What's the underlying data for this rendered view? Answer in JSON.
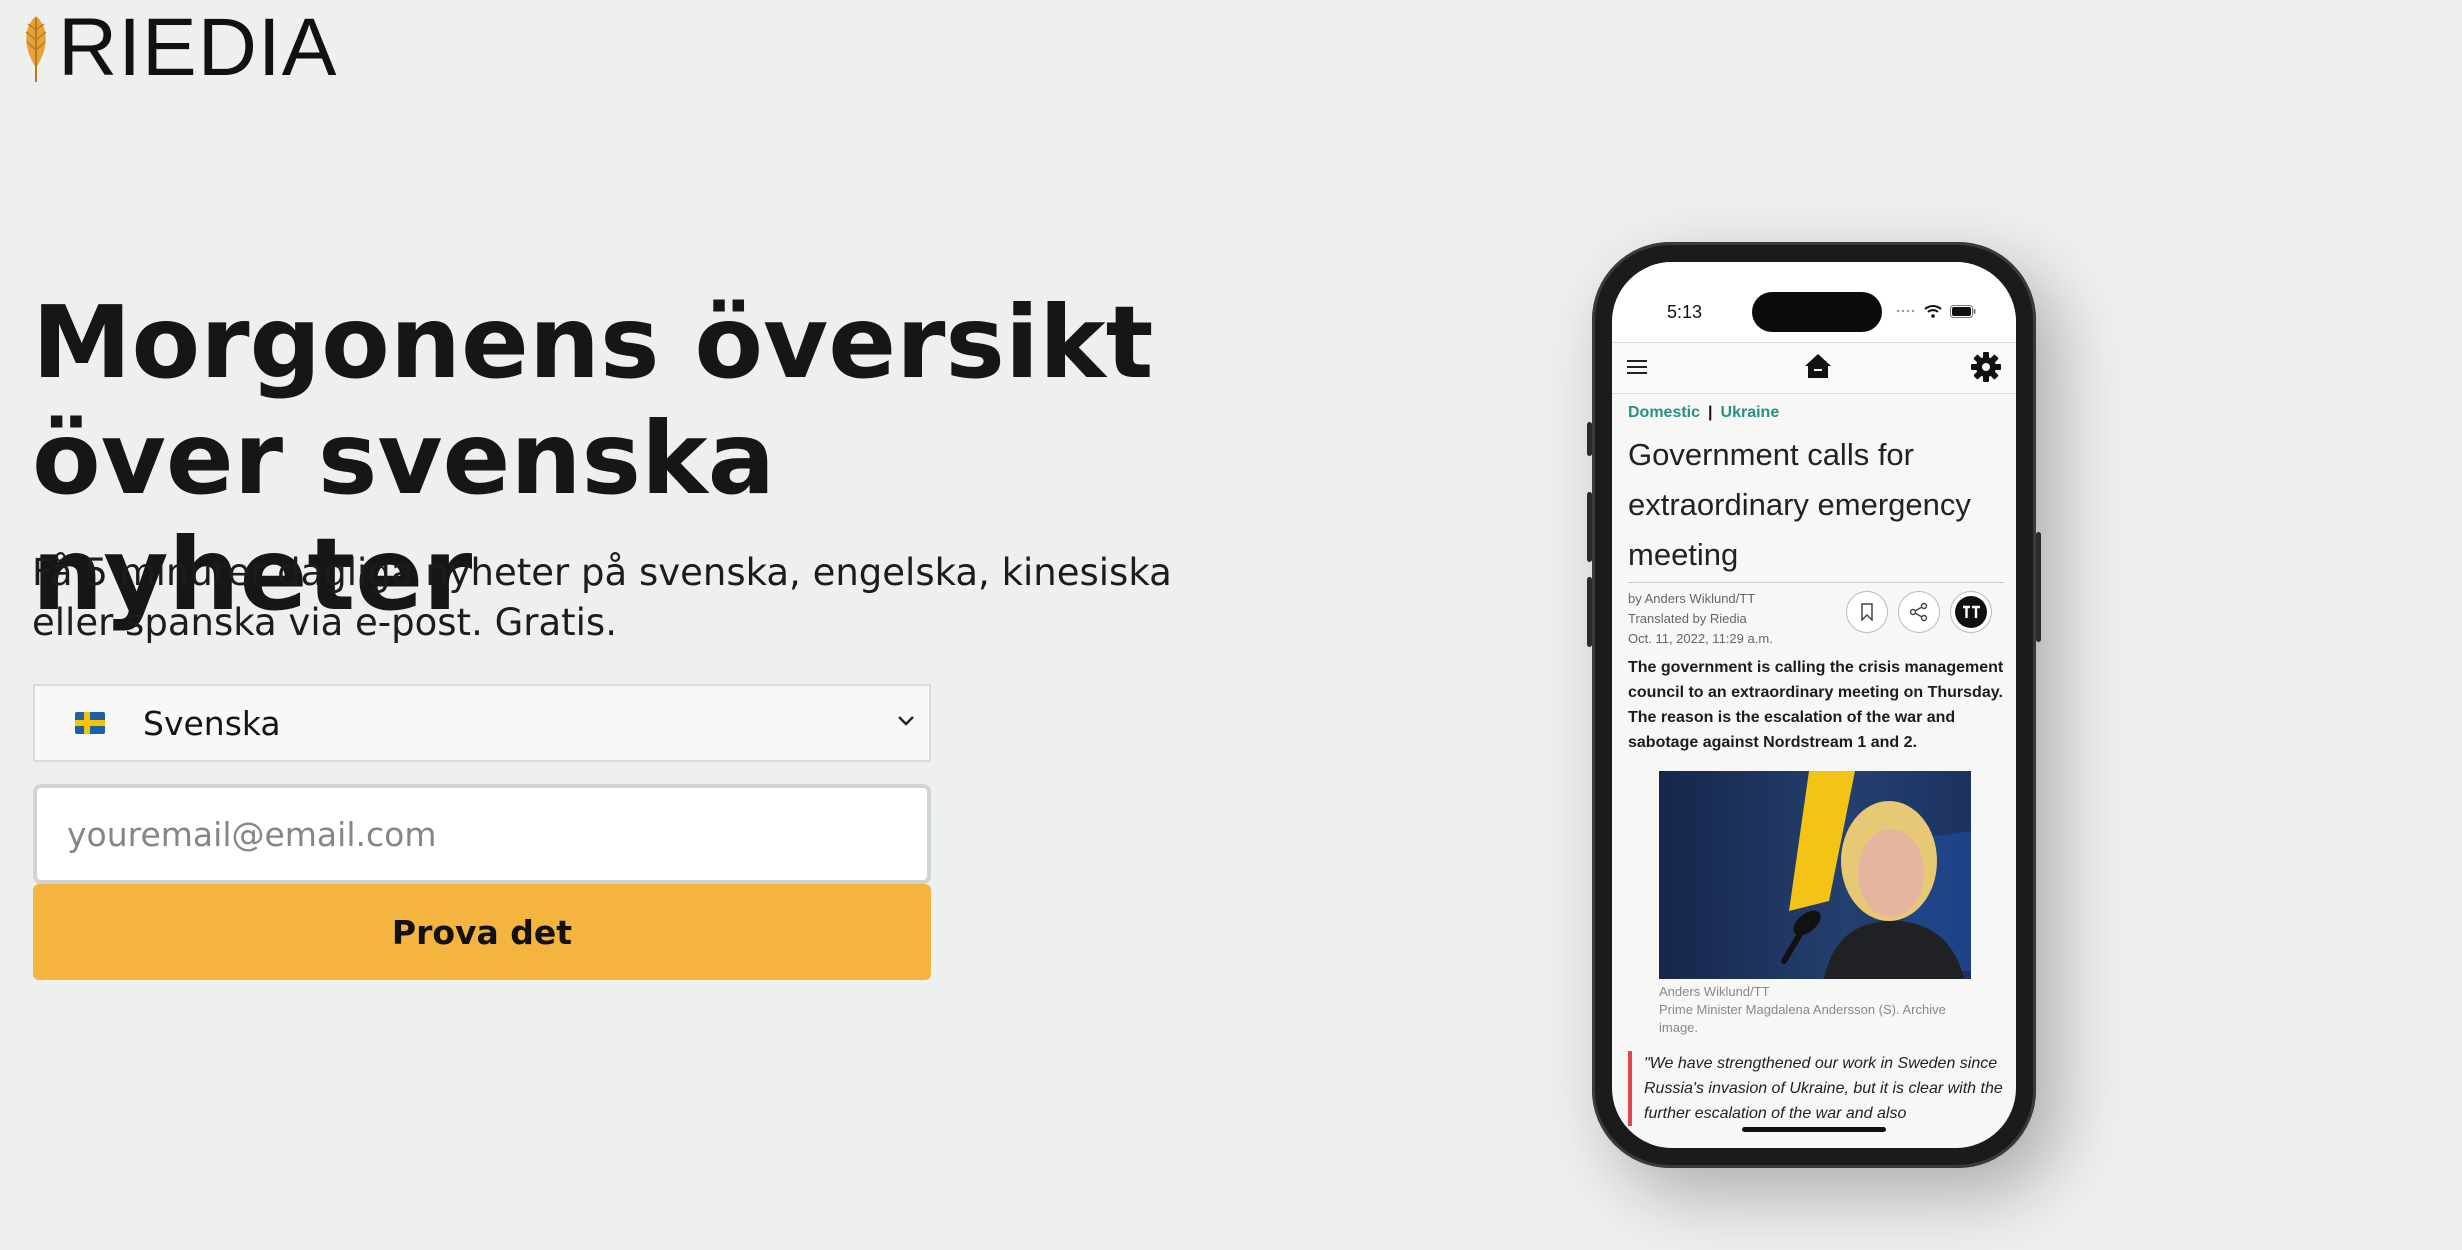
{
  "brand": {
    "name": "RIEDIA",
    "accent": "#e5a13a"
  },
  "hero": {
    "headline_line1": "Morgonens översikt",
    "headline_line2": "över svenska nyheter",
    "subtext": "Få 5 minuter dagliga nyheter på svenska, engelska, kinesiska eller spanska via e-post. Gratis."
  },
  "form": {
    "language_selected": "Svenska",
    "language_flag": "sweden-flag-icon",
    "email_placeholder": "youremail@email.com",
    "email_value": "",
    "cta_label": "Prova det",
    "cta_color": "#f5b440"
  },
  "phone": {
    "status_time": "5:13",
    "article": {
      "category_1": "Domestic",
      "category_2": "Ukraine",
      "category_color": "#2a8f88",
      "title": "Government calls for extraordinary emergency meeting",
      "byline": "by Anders Wiklund/TT",
      "translated": "Translated by Riedia",
      "date": "Oct. 11, 2022, 11:29 a.m.",
      "lead": "The government is calling the crisis management council to an extraordinary meeting on Thursday. The reason is the escalation of the war and sabotage against Nordstream 1 and 2.",
      "photo_credit": "Anders Wiklund/TT",
      "photo_caption": "Prime Minister Magdalena Andersson (S). Archive image.",
      "quote": "\"We have strengthened our work in Sweden since Russia's invasion of Ukraine, but it is clear with the further escalation of the war and also"
    }
  }
}
